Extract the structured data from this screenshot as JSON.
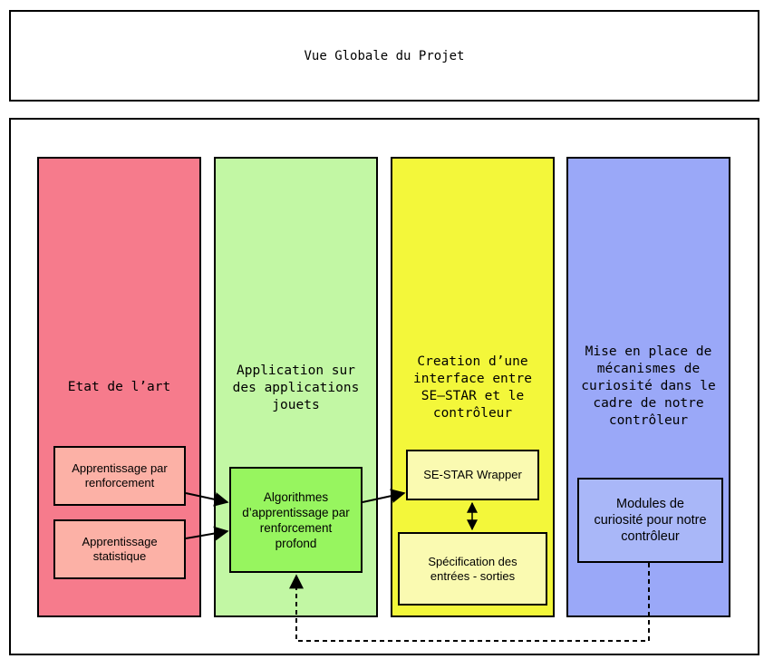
{
  "header": {
    "title": "Vue Globale du Projet"
  },
  "columns": [
    {
      "title": "Etat de l’art",
      "color": "#f67b8c"
    },
    {
      "title": "Application sur\ndes applications\njouets",
      "color": "#c2f7a4"
    },
    {
      "title": "Creation d’une\ninterface entre\nSE–STAR et le\ncontrôleur",
      "color": "#f3f73a"
    },
    {
      "title": "Mise en place de\nmécanismes de\ncuriosité dans le\ncadre de notre\ncontrôleur",
      "color": "#9aa8f8"
    }
  ],
  "nodes": {
    "apprentissage_renforcement": {
      "label": "Apprentissage par\nrenforcement",
      "color": "#fcb1a6"
    },
    "apprentissage_statistique": {
      "label": "Apprentissage\nstatistique",
      "color": "#fcb1a6"
    },
    "algorithmes_deep_rl": {
      "label": "Algorithmes\nd’apprentissage par\nrenforcement\nprofond",
      "color": "#97f55f"
    },
    "se_star_wrapper": {
      "label": "SE-STAR Wrapper",
      "color": "#fafab1"
    },
    "specification_es": {
      "label": "Spécification des\nentrées - sorties",
      "color": "#fafab1"
    },
    "modules_curiosite": {
      "label": "Modules de\ncuriosité pour notre\ncontrôleur",
      "color": "#a9b7f8"
    }
  },
  "edges": [
    {
      "from": "apprentissage_renforcement",
      "to": "algorithmes_deep_rl",
      "style": "solid",
      "arrow": "end"
    },
    {
      "from": "apprentissage_statistique",
      "to": "algorithmes_deep_rl",
      "style": "solid",
      "arrow": "end"
    },
    {
      "from": "algorithmes_deep_rl",
      "to": "se_star_wrapper",
      "style": "solid",
      "arrow": "end"
    },
    {
      "from": "se_star_wrapper",
      "to": "specification_es",
      "style": "solid",
      "arrow": "both"
    },
    {
      "from": "modules_curiosite",
      "to": "algorithmes_deep_rl",
      "style": "dashed",
      "arrow": "end"
    }
  ]
}
